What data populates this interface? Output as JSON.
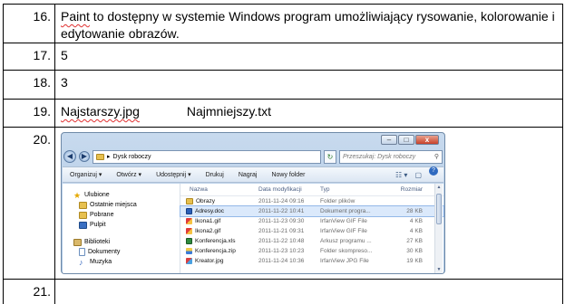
{
  "rows": [
    {
      "num": "16.",
      "text_word1": "Paint",
      "text_rest": " to dostępny w systemie Windows program umożliwiający rysowanie, kolorowanie i edytowanie obrazów."
    },
    {
      "num": "17.",
      "text": "5"
    },
    {
      "num": "18.",
      "text": "3"
    },
    {
      "num": "19.",
      "oldest": "Najstarszy.jpg",
      "smallest": "Najmniejszy.txt"
    },
    {
      "num": "20."
    },
    {
      "num": "21.",
      "text": ""
    }
  ],
  "explorer": {
    "window_controls": {
      "minimize": "–",
      "maximize": "□",
      "close": "x"
    },
    "back_glyph": "◀",
    "forward_glyph": "▶",
    "address_arrow": "▸",
    "address": "Dysk roboczy",
    "search_placeholder": "Przeszukaj: Dysk roboczy",
    "search_glyph": "⚲",
    "refresh_glyph": "↻",
    "toolbar": {
      "organize": "Organizuj ▾",
      "open": "Otwórz ▾",
      "share": "Udostępnij ▾",
      "print": "Drukuj",
      "burn": "Nagraj",
      "new_folder": "Nowy folder",
      "views_glyph": "☷ ▾",
      "preview_glyph": "▢",
      "help_glyph": "?"
    },
    "nav_pane": {
      "favorites": "Ulubione",
      "recent": "Ostatnie miejsca",
      "downloads": "Pobrane",
      "desktop": "Pulpit",
      "libraries": "Biblioteki",
      "documents": "Dokumenty",
      "music": "Muzyka"
    },
    "columns": {
      "name": "Nazwa",
      "date": "Data modyfikacji",
      "type": "Typ",
      "size": "Rozmiar"
    },
    "files": [
      {
        "name": "Obrazy",
        "date": "2011-11-24 09:16",
        "type": "Folder plików",
        "size": "",
        "icon": "folder"
      },
      {
        "name": "Adresy.doc",
        "date": "2011-11-22 10:41",
        "type": "Dokument progra...",
        "size": "28 KB",
        "icon": "word"
      },
      {
        "name": "Ikona1.gif",
        "date": "2011-11-23 09:30",
        "type": "IrfanView GIF File",
        "size": "4 KB",
        "icon": "gif"
      },
      {
        "name": "Ikona2.gif",
        "date": "2011-11-21 09:31",
        "type": "IrfanView GIF File",
        "size": "4 KB",
        "icon": "gif"
      },
      {
        "name": "Konferencja.xls",
        "date": "2011-11-22 10:48",
        "type": "Arkusz programu ...",
        "size": "27 KB",
        "icon": "xls"
      },
      {
        "name": "Konferencja.zip",
        "date": "2011-11-23 10:23",
        "type": "Folder skompreso...",
        "size": "30 KB",
        "icon": "zip"
      },
      {
        "name": "Kreator.jpg",
        "date": "2011-11-24 10:36",
        "type": "IrfanView JPG File",
        "size": "19 KB",
        "icon": "jpg"
      }
    ]
  }
}
